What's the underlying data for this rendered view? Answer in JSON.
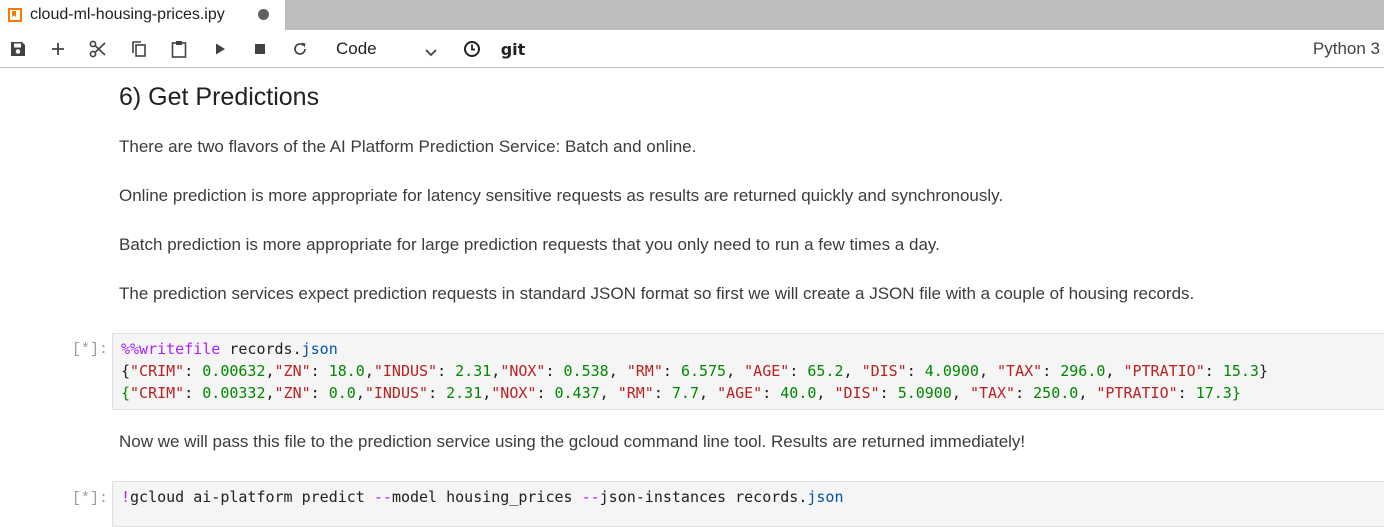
{
  "tab": {
    "filename": "cloud-ml-housing-prices.ipy",
    "icon": "notebook-icon",
    "accent": "#f57c00"
  },
  "toolbar": {
    "icons": [
      "save-icon",
      "add-cell-icon",
      "cut-icon",
      "copy-icon",
      "paste-icon",
      "run-icon",
      "stop-icon",
      "restart-icon",
      "clock-icon"
    ],
    "cell_type": "Code",
    "git_label": "git",
    "kernel": "Python 3"
  },
  "notebook": {
    "heading": "6) Get Predictions",
    "paragraphs": [
      "There are two flavors of the AI Platform Prediction Service: Batch and online.",
      "Online prediction is more appropriate for latency sensitive requests as results are returned quickly and synchronously.",
      "Batch prediction is more appropriate for large prediction requests that you only need to run a few times a day.",
      "The prediction services expect prediction requests in standard JSON format so first we will create a JSON file with a couple of housing records."
    ],
    "cell1": {
      "prompt": "[*]:",
      "magic": "%%writefile",
      "filename_base": "records.",
      "filename_ext": "json",
      "records": [
        {
          "CRIM": "0.00632",
          "ZN": "18.0",
          "INDUS": "2.31",
          "NOX": "0.538",
          "RM": "6.575",
          "AGE": "65.2",
          "DIS": "4.0900",
          "TAX": "296.0",
          "PTRATIO": "15.3"
        },
        {
          "CRIM": "0.00332",
          "ZN": "0.0",
          "INDUS": "2.31",
          "NOX": "0.437",
          "RM": "7.7",
          "AGE": "40.0",
          "DIS": "5.0900",
          "TAX": "250.0",
          "PTRATIO": "17.3"
        }
      ]
    },
    "between_text": "Now we will pass this file to the prediction service using the gcloud command line tool. Results are returned immediately!",
    "cell2": {
      "prompt": "[*]:",
      "bang": "!",
      "cmd": "gcloud ai-platform predict ",
      "flag1": "--",
      "arg1": "model housing_prices ",
      "flag2": "--",
      "arg2": "json-instances records.",
      "ext": "json"
    }
  }
}
